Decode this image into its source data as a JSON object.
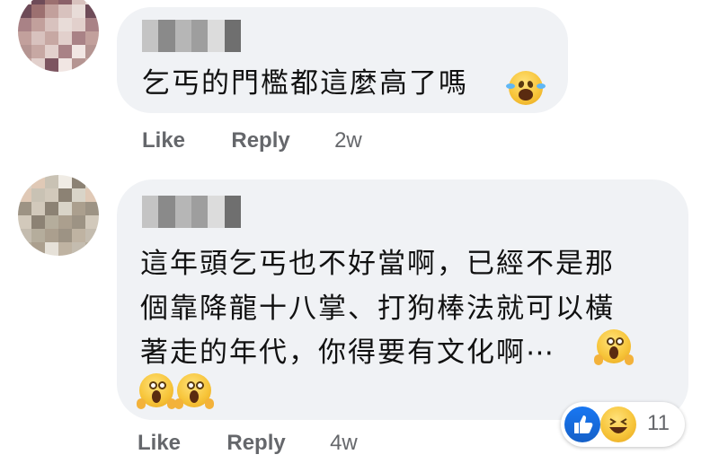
{
  "colors": {
    "bubble_bg": "#f0f2f5",
    "action_text": "#65676b",
    "like_blue": "#1877f2"
  },
  "comments": [
    {
      "text_lines": [
        "乞丐的門檻都這麼高了嗎"
      ],
      "emoji": [
        "joy-emoji"
      ],
      "actions": {
        "like": "Like",
        "reply": "Reply",
        "time": "2w"
      }
    },
    {
      "text_lines": [
        "這年頭乞丐也不好當啊，已經不是那",
        "個靠降龍十八掌、打狗棒法就可以橫",
        "著走的年代，你得要有文化啊⋯"
      ],
      "emoji": [
        "scream-emoji",
        "scream-emoji",
        "scream-emoji"
      ],
      "actions": {
        "like": "Like",
        "reply": "Reply",
        "time": "4w"
      },
      "reactions": {
        "icons": [
          "like-icon",
          "haha-icon"
        ],
        "count": "11"
      }
    }
  ]
}
